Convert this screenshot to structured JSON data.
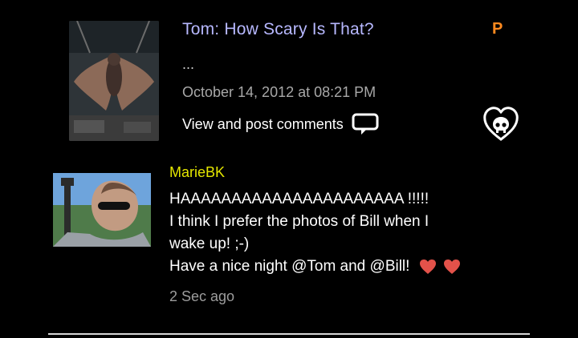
{
  "post": {
    "title": "Tom: How Scary Is That?",
    "badge": "P",
    "excerpt": "...",
    "date": "October 14, 2012 at 08:21 PM",
    "comments_link": "View and post comments",
    "icons": {
      "comment": "comment-bubble-icon",
      "favorite": "skull-heart-icon"
    },
    "colors": {
      "title": "#b7b8ff",
      "badge": "#ff8a1f"
    }
  },
  "comment": {
    "author": "MarieBK",
    "lines": [
      "HAAAAAAAAAAAAAAAAAAAAAA !!!!!",
      "I think I prefer the photos of Bill when I",
      "wake up! ;-)",
      "Have a nice night @Tom and @Bill!"
    ],
    "time": "2 Sec ago",
    "icons": {
      "emoji": "red-heart-icon"
    },
    "colors": {
      "author": "#e4e600",
      "heart": "#e3524a"
    }
  }
}
